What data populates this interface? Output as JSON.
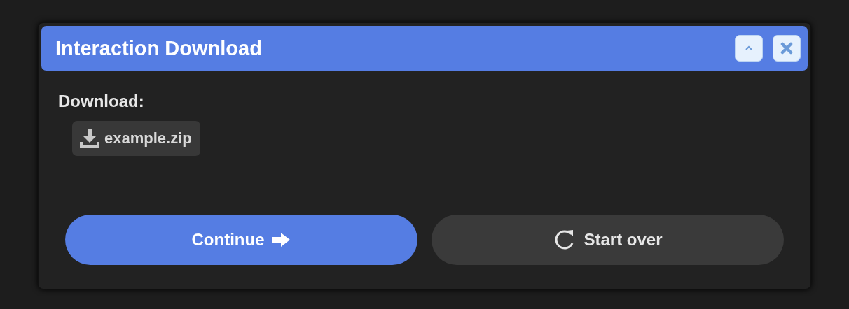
{
  "window": {
    "title": "Interaction Download"
  },
  "download": {
    "label": "Download:",
    "file": "example.zip"
  },
  "buttons": [
    {
      "label": "Continue",
      "kind": "primary"
    },
    {
      "label": "Start over",
      "kind": "secondary"
    }
  ]
}
